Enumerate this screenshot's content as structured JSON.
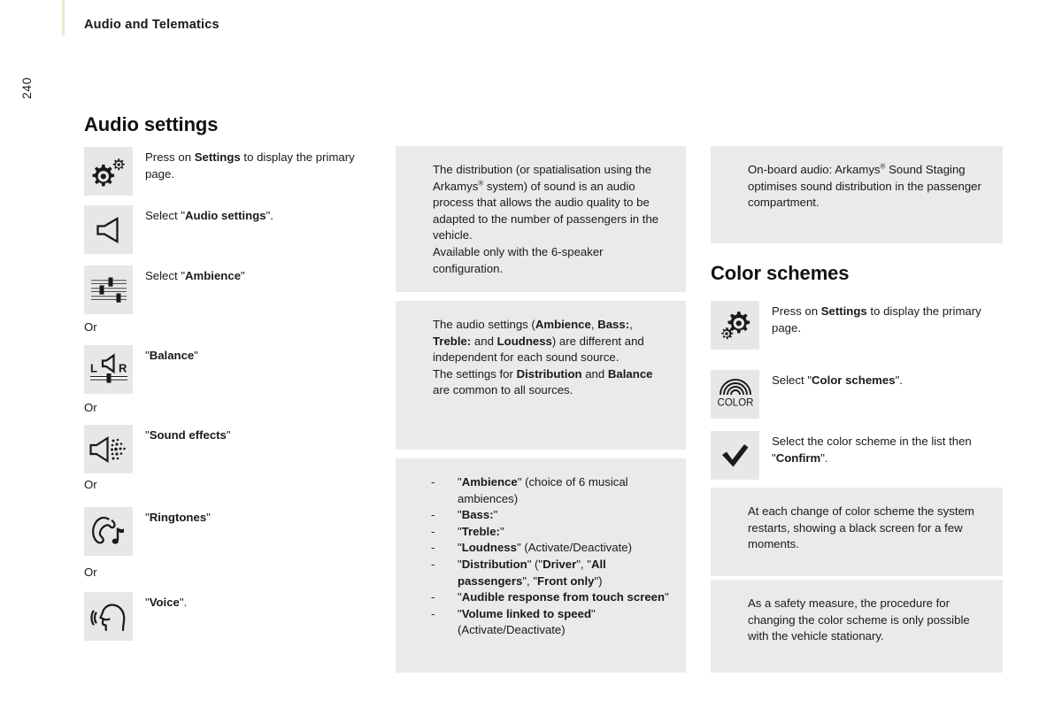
{
  "page": {
    "header_title": "Audio and Telematics",
    "page_number": "240"
  },
  "sections": {
    "audio_settings": {
      "heading": "Audio settings",
      "steps": [
        {
          "icon": "settings-gears-icon",
          "text_html": "Press on <b>Settings</b> to display the primary page."
        },
        {
          "icon": "speaker-icon",
          "text_html": "Select \"<b>Audio settings</b>\"."
        },
        {
          "icon": "equalizer-sliders-icon",
          "text_html": "Select \"<b>Ambience</b>\""
        },
        {
          "icon": "balance-lr-icon",
          "text_html": "\"<b>Balance</b>\""
        },
        {
          "icon": "sound-effects-icon",
          "text_html": "\"<b>Sound effects</b>\""
        },
        {
          "icon": "ringtones-icon",
          "text_html": "\"<b>Ringtones</b>\""
        },
        {
          "icon": "voice-icon",
          "text_html": "\"<b>Voice</b>\"."
        }
      ],
      "or_labels": [
        "Or",
        "Or",
        "Or",
        "Or"
      ]
    },
    "color_schemes": {
      "heading": "Color schemes",
      "steps": [
        {
          "icon": "settings-gears-icon",
          "text_html": "Press on <b>Settings</b> to display the primary page."
        },
        {
          "icon": "color-rainbow-icon",
          "text_html": "Select \"<b>Color schemes</b>\"."
        },
        {
          "icon": "checkmark-icon",
          "text_html": "Select the color scheme in the list then \"<b>Confirm</b>\"."
        }
      ],
      "color_icon_label": "COLOR"
    }
  },
  "callouts": {
    "distribution_warning": {
      "mark": "warning-exclamation-icon",
      "body_html": "The distribution (or spatialisation using the Arkamys<sup>®</sup> system) of sound is an audio process that allows the audio quality to be adapted to the number of passengers in the vehicle.<br>Available only with the 6-speaker configuration."
    },
    "audio_settings_warning": {
      "mark": "warning-exclamation-icon",
      "body_html": "The audio settings (<b>Ambience</b>, <b>Bass:</b>, <b>Treble:</b> and <b>Loudness</b>) are different and independent for each sound source.<br>The settings for <b>Distribution</b> and <b>Balance</b> are common to all sources."
    },
    "settings_list_warning": {
      "mark": "warning-exclamation-icon",
      "dash": "-",
      "items_html": [
        "\"<b>Ambience</b>\" (choice of 6 musical ambiences)",
        "\"<b>Bass:</b>\"",
        "\"<b>Treble:</b>\"",
        "\"<b>Loudness</b>\" (Activate/Deactivate)",
        "\"<b>Distribution</b>\" (\"<b>Driver</b>\", \"<b>All passengers</b>\", \"<b>Front only</b>\")",
        "\"<b>Audible response from touch screen</b>\"",
        "\"<b>Volume linked to speed</b>\" (Activate/Deactivate)"
      ]
    },
    "onboard_audio_info": {
      "mark": "info-icon",
      "body_html": "On-board audio: Arkamys<sup>®</sup> Sound Staging optimises sound distribution in the passenger compartment."
    },
    "restart_info": {
      "mark": "info-icon",
      "body_html": "At each change of color scheme the system restarts, showing a black screen for a few moments."
    },
    "safety_warning": {
      "mark": "warning-exclamation-icon",
      "body_html": "As a safety measure, the procedure for changing the color scheme is only possible with the vehicle stationary."
    }
  },
  "colors": {
    "warning_red": "#e8112d",
    "info_blue": "#0a9bdb",
    "tile_gray": "#e6e7e8",
    "callout_gray": "#e9eaeb",
    "header_rule": "#f0e6d2"
  }
}
